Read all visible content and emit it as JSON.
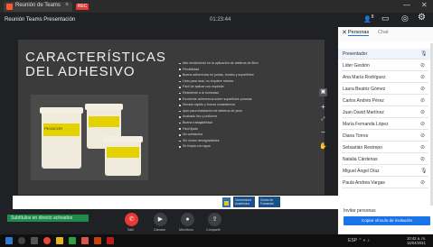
{
  "browser": {
    "tab_title": "Reunión de Teams",
    "rec_label": "REC",
    "close_glyph": "×",
    "minimize_glyph": "—",
    "window_close_glyph": "✕"
  },
  "meeting": {
    "name": "Reunión Teams Presentación",
    "elapsed": "01:23:44",
    "people_count": "8",
    "icons": [
      "people-icon",
      "chat-icon",
      "activities-icon",
      "settings-icon"
    ]
  },
  "slide": {
    "title_line1": "CARACTERÍSTICAS",
    "title_line2": "DEL ADHESIVO",
    "product_label": "PEGACOR",
    "features": [
      "Alto rendimiento en la aplicación de tableros de fibra",
      "Flexibilidad",
      "Buena adherencia en juntas, bordes y superficies",
      "Listo para usar, no requiere mezcla",
      "Fácil de aplicar con espátula",
      "Resistente a la humedad",
      "Excelente adherencia sobre superficies porosas",
      "Secado rápido y buena consistencia",
      "Apto para instalación de tableros de yeso",
      "Acabado liso y uniforme",
      "Buena trabajabilidad",
      "Fácil lijado",
      "No contamina",
      "Sin olores desagradables",
      "Se limpia con agua"
    ],
    "footer_box1": [
      "Vicerrectoría",
      "Académica"
    ],
    "footer_box2": [
      "Centro de",
      "Formación"
    ]
  },
  "call": {
    "caption": "Subtítulos en directo activados",
    "buttons": [
      {
        "name": "leave",
        "label": "Salir"
      },
      {
        "name": "camera",
        "label": "Cámara"
      },
      {
        "name": "mic",
        "label": "Micrófono"
      },
      {
        "name": "share",
        "label": "Compartir"
      },
      {
        "name": "more",
        "label": "Más"
      }
    ]
  },
  "panel": {
    "tab_people": "Personas",
    "tab_chat": "Chat",
    "participants": [
      {
        "name": "Presentador",
        "icon": "mic-on"
      },
      {
        "name": "Lider Gestión",
        "icon": "mic-off"
      },
      {
        "name": "Ana María Rodríguez",
        "icon": "mic-off"
      },
      {
        "name": "Laura Beatriz Gómez",
        "icon": "mic-off"
      },
      {
        "name": "Carlos Andrés Pérez",
        "icon": "mic-off"
      },
      {
        "name": "Juan David Martínez",
        "icon": "mic-off"
      },
      {
        "name": "María Fernanda López",
        "icon": "mic-off"
      },
      {
        "name": "Diana Torres",
        "icon": "mic-off"
      },
      {
        "name": "Sebastián Restrepo",
        "icon": "mic-off"
      },
      {
        "name": "Natalia Cárdenas",
        "icon": "mic-off"
      },
      {
        "name": "Miguel Ángel Díaz",
        "icon": "mic-on"
      },
      {
        "name": "Paula Andrea Vargas",
        "icon": "mic-off"
      }
    ],
    "invite_label": "Invitar personas",
    "invite_button": "Copiar vínculo de invitación"
  },
  "taskbar": {
    "time": "10:42 a. m.",
    "date": "15/04/2021",
    "sys": "ESP  ⌃  ◐  ♪"
  },
  "colors": {
    "accent": "#1a73e8",
    "leave": "#e53935",
    "caption": "#1f8a4c"
  }
}
